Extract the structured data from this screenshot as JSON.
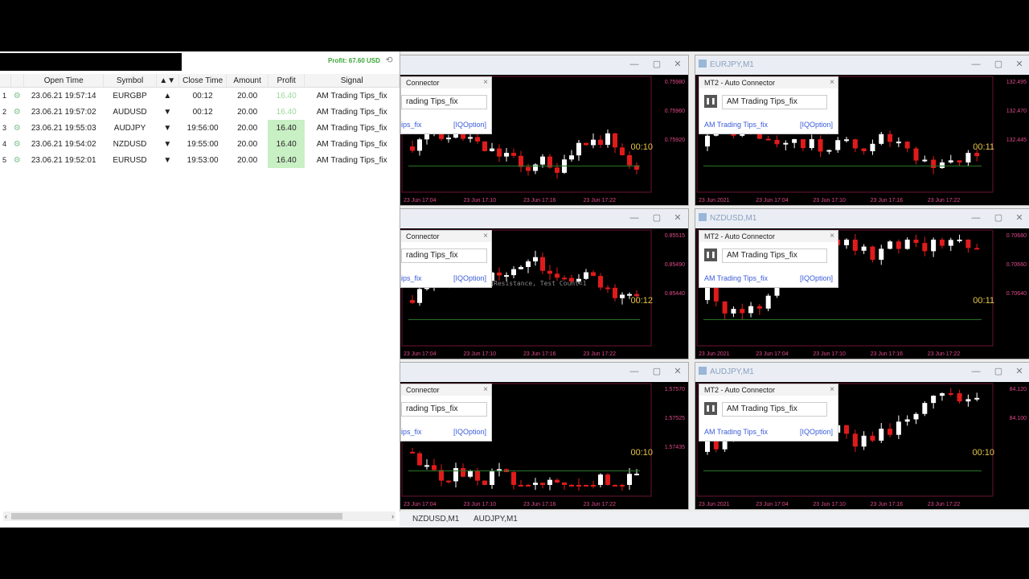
{
  "trade_panel": {
    "profit_label": "Profit: 67.60 USD",
    "columns": [
      "Open Time",
      "Symbol",
      "▲▼",
      "Close Time",
      "Amount",
      "Profit",
      "Signal"
    ],
    "rows": [
      {
        "idx": "1",
        "open_time": "23.06.21 19:57:14",
        "symbol": "EURGBP",
        "dir": "▲",
        "close_time": "00:12",
        "amount": "20.00",
        "profit": "16.40",
        "signal": "AM Trading Tips_fix",
        "status": "open"
      },
      {
        "idx": "2",
        "open_time": "23.06.21 19:57:02",
        "symbol": "AUDUSD",
        "dir": "▼",
        "close_time": "00:12",
        "amount": "20.00",
        "profit": "16.40",
        "signal": "AM Trading Tips_fix",
        "status": "open"
      },
      {
        "idx": "3",
        "open_time": "23.06.21 19:55:03",
        "symbol": "AUDJPY",
        "dir": "▼",
        "close_time": "19:56:00",
        "amount": "20.00",
        "profit": "16.40",
        "signal": "AM Trading Tips_fix",
        "status": "closed"
      },
      {
        "idx": "4",
        "open_time": "23.06.21 19:54:02",
        "symbol": "NZDUSD",
        "dir": "▼",
        "close_time": "19:55:00",
        "amount": "20.00",
        "profit": "16.40",
        "signal": "AM Trading Tips_fix",
        "status": "closed"
      },
      {
        "idx": "5",
        "open_time": "23.06.21 19:52:01",
        "symbol": "EURUSD",
        "dir": "▼",
        "close_time": "19:53:00",
        "amount": "20.00",
        "profit": "16.40",
        "signal": "AM Trading Tips_fix",
        "status": "closed"
      }
    ]
  },
  "charts": [
    {
      "title": "",
      "timer": "00:10",
      "connector_title": "Connector",
      "dropdown": "rading Tips_fix",
      "link_left": "ips_fix",
      "link_right": "[IQOption]",
      "prices": [
        "0.75980",
        "0.75960",
        "0.75920"
      ],
      "times": [
        "23 Jun 17:04",
        "23 Jun 17:10",
        "23 Jun 17:16",
        "23 Jun 17:22"
      ]
    },
    {
      "title": "EURJPY,M1",
      "timer": "00:11",
      "connector_title": "MT2 - Auto Connector",
      "dropdown": "AM Trading Tips_fix",
      "link_left": "AM Trading Tips_fix",
      "link_right": "[IQOption]",
      "prices": [
        "132.495",
        "132.470",
        "132.445"
      ],
      "times": [
        "23 Jun 2021",
        "23 Jun 17:04",
        "23 Jun 17:10",
        "23 Jun 17:16",
        "23 Jun 17:22"
      ]
    },
    {
      "title": "",
      "timer": "00:12",
      "connector_title": "Connector",
      "dropdown": "rading Tips_fix",
      "link_left": "ips_fix",
      "link_right": "[IQOption]",
      "prices": [
        "0.85515",
        "0.85490",
        "0.85440"
      ],
      "times": [
        "23 Jun 17:04",
        "23 Jun 17:10",
        "23 Jun 17:16",
        "23 Jun 17:22"
      ],
      "annotation": "Resistance, Test Count=1"
    },
    {
      "title": "NZDUSD,M1",
      "timer": "00:11",
      "connector_title": "MT2 - Auto Connector",
      "dropdown": "AM Trading Tips_fix",
      "link_left": "AM Trading Tips_fix",
      "link_right": "[IQOption]",
      "prices": [
        "0.70680",
        "0.70660",
        "0.70640"
      ],
      "times": [
        "23 Jun 2021",
        "23 Jun 17:04",
        "23 Jun 17:10",
        "23 Jun 17:16",
        "23 Jun 17:22"
      ]
    },
    {
      "title": "",
      "timer": "00:10",
      "connector_title": "Connector",
      "dropdown": "rading Tips_fix",
      "link_left": "ips_fix",
      "link_right": "[IQOption]",
      "prices": [
        "1.57570",
        "1.57525",
        "1.57435"
      ],
      "times": [
        "23 Jun 17:04",
        "23 Jun 17:10",
        "23 Jun 17:16",
        "23 Jun 17:22"
      ]
    },
    {
      "title": "AUDJPY,M1",
      "timer": "00:10",
      "connector_title": "MT2 - Auto Connector",
      "dropdown": "AM Trading Tips_fix",
      "link_left": "AM Trading Tips_fix",
      "link_right": "[IQOption]",
      "prices": [
        "84.120",
        "84.100"
      ],
      "times": [
        "23 Jun 2021",
        "23 Jun 17:04",
        "23 Jun 17:10",
        "23 Jun 17:16",
        "23 Jun 17:22"
      ]
    }
  ],
  "bottom_tabs": [
    "NZDUSD,M1",
    "AUDJPY,M1"
  ],
  "colors": {
    "bull": "#ffffff",
    "bear": "#e01b1b",
    "accent": "#e24a8b",
    "timer": "#e5c544",
    "profit_bg": "#c9efc5"
  }
}
